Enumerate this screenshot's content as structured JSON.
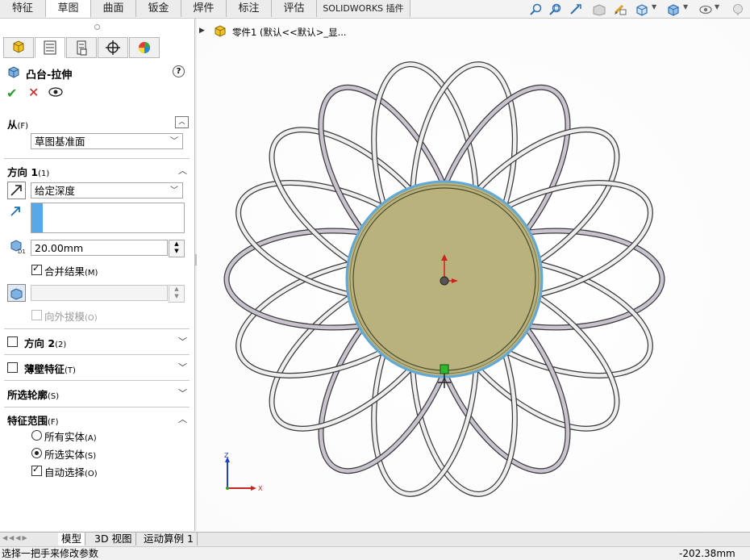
{
  "ribbon": {
    "tabs": [
      {
        "label": "特征"
      },
      {
        "label": "草图"
      },
      {
        "label": "曲面"
      },
      {
        "label": "钣金"
      },
      {
        "label": "焊件"
      },
      {
        "label": "标注"
      },
      {
        "label": "评估"
      },
      {
        "label": "SOLIDWORKS 插件"
      }
    ],
    "active_tab": "草图"
  },
  "tree": {
    "part_label": "零件1  (默认<<默认>_显..."
  },
  "pm": {
    "title": "凸台-拉伸",
    "from": {
      "title": "从",
      "shortcut": "(F)",
      "value": "草图基准面"
    },
    "direction1": {
      "title": "方向 1",
      "shortcut": "(1)",
      "end_condition": "给定深度",
      "depth": "20.00mm",
      "merge_label": "合并结果",
      "merge_shortcut": "(M)",
      "draft_label": "向外拔模",
      "draft_shortcut": "(O)"
    },
    "direction2": {
      "title": "方向 2",
      "shortcut": "(2)"
    },
    "thin": {
      "title": "薄壁特征",
      "shortcut": "(T)"
    },
    "contours": {
      "title": "所选轮廓",
      "shortcut": "(S)"
    },
    "scope": {
      "title": "特征范围",
      "shortcut": "(F)",
      "all_bodies": "所有实体",
      "all_shortcut": "(A)",
      "selected_bodies": "所选实体",
      "selected_shortcut": "(S)",
      "auto_select": "自动选择",
      "auto_shortcut": "(O)"
    }
  },
  "bottom_tabs": [
    "模型",
    "3D 视图",
    "运动算例 1"
  ],
  "status": {
    "message": "选择一把手来修改参数",
    "coordinate": "-202.38mm"
  },
  "colors": {
    "disk_fill": "#b9b27d",
    "disk_edge": "#5fa8d8",
    "accent_green": "#2e9b2e",
    "accent_red": "#cc2222"
  }
}
